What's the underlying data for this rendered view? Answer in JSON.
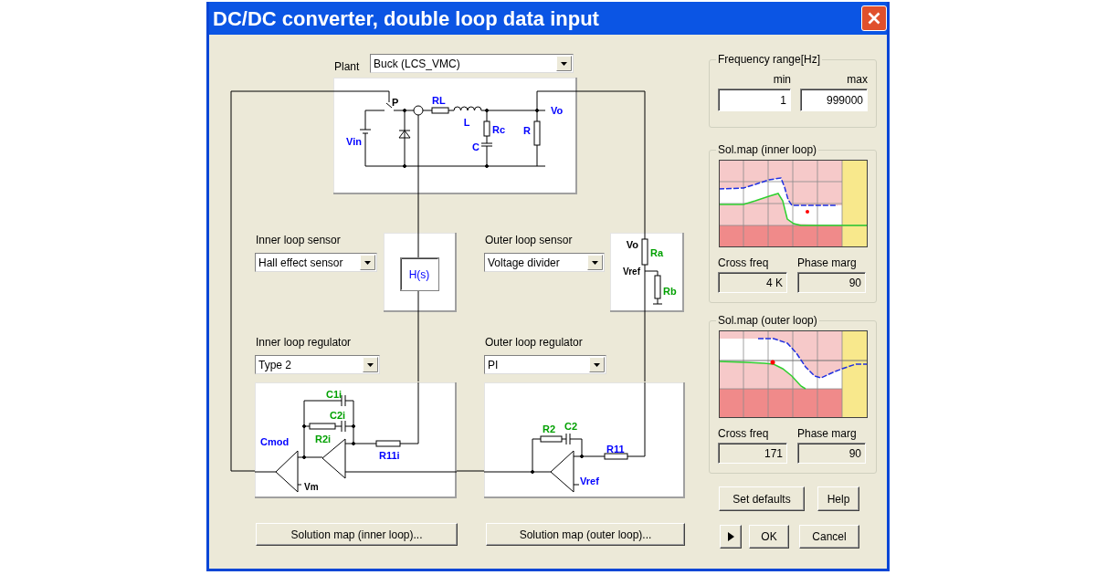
{
  "window": {
    "title": "DC/DC converter, double loop data input"
  },
  "plant": {
    "label": "Plant",
    "value": "Buck (LCS_VMC)",
    "schematic_labels": [
      {
        "text": "P",
        "color": "#000000"
      },
      {
        "text": "RL",
        "color": "#0000ff"
      },
      {
        "text": "L",
        "color": "#0000ff"
      },
      {
        "text": "Rc",
        "color": "#0000ff"
      },
      {
        "text": "C",
        "color": "#0000ff"
      },
      {
        "text": "R",
        "color": "#0000ff"
      },
      {
        "text": "Vo",
        "color": "#0000ff"
      },
      {
        "text": "Vin",
        "color": "#0000ff"
      }
    ]
  },
  "inner_loop_sensor": {
    "label": "Inner loop sensor",
    "value": "Hall effect sensor",
    "block_label": "H(s)"
  },
  "outer_loop_sensor": {
    "label": "Outer loop sensor",
    "value": "Voltage divider",
    "schematic_labels": [
      {
        "text": "Vo",
        "color": "#000000"
      },
      {
        "text": "Ra",
        "color": "#00a000"
      },
      {
        "text": "Vref",
        "color": "#000000"
      },
      {
        "text": "Rb",
        "color": "#00a000"
      }
    ]
  },
  "inner_loop_regulator": {
    "label": "Inner loop regulator",
    "value": "Type 2",
    "schematic_labels": [
      {
        "text": "C1i",
        "color": "#00a000"
      },
      {
        "text": "C2i",
        "color": "#00a000"
      },
      {
        "text": "R2i",
        "color": "#00a000"
      },
      {
        "text": "R11i",
        "color": "#0000ff"
      },
      {
        "text": "Cmod",
        "color": "#0000ff"
      },
      {
        "text": "Vm",
        "color": "#000000"
      }
    ]
  },
  "outer_loop_regulator": {
    "label": "Outer loop regulator",
    "value": "PI",
    "schematic_labels": [
      {
        "text": "R2",
        "color": "#00a000"
      },
      {
        "text": "C2",
        "color": "#00a000"
      },
      {
        "text": "R11",
        "color": "#0000ff"
      },
      {
        "text": "Vref",
        "color": "#0000ff"
      }
    ]
  },
  "solution_map_buttons": [
    {
      "label": "Solution map (inner loop)..."
    },
    {
      "label": "Solution map (outer loop)..."
    }
  ],
  "frequency_range": {
    "title": "Frequency range[Hz]",
    "fields": [
      {
        "label": "min",
        "value": "1"
      },
      {
        "label": "max",
        "value": "999000"
      }
    ]
  },
  "solution_maps": [
    {
      "kind": "inner",
      "title": "Sol.map (inner loop)",
      "fields": [
        {
          "label": "Cross freq",
          "value": "4 K",
          "disabled": true
        },
        {
          "label": "Phase marg",
          "value": "90",
          "disabled": true
        }
      ]
    },
    {
      "kind": "outer",
      "title": "Sol.map (outer loop)",
      "fields": [
        {
          "label": "Cross freq",
          "value": "171",
          "disabled": true
        },
        {
          "label": "Phase marg",
          "value": "90",
          "disabled": true
        }
      ]
    }
  ],
  "buttons": [
    {
      "label": "Set defaults"
    },
    {
      "label": "Help"
    }
  ],
  "dialog_buttons": [
    {
      "label": "OK"
    },
    {
      "label": "Cancel"
    }
  ]
}
